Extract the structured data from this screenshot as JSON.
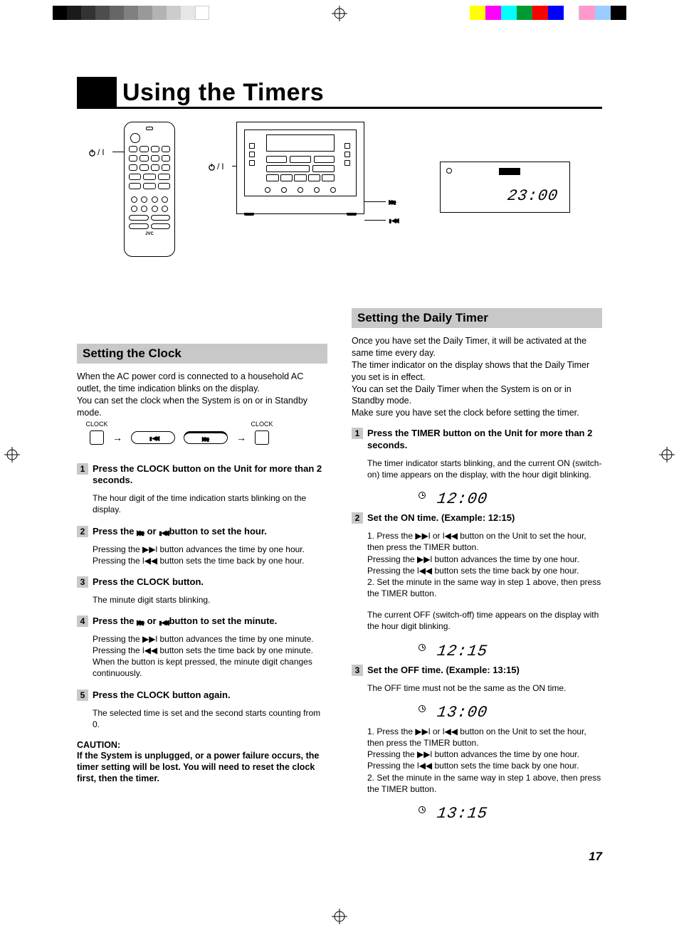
{
  "page_number": "17",
  "title": "Using the Timers",
  "lcd_main": "23:00",
  "remote_brand": "JVC",
  "power_label_suffix": "/ l",
  "unit_callouts": {
    "ff": "▶▶l",
    "rw": "l◀◀"
  },
  "left": {
    "heading": "Setting the Clock",
    "intro": "When the AC power cord is connected to a household AC outlet, the time indication blinks on the display.\nYou can set the clock when the System is on or in Standby mode.",
    "diagram_labels": {
      "clock": "CLOCK",
      "rw": "l◀◀",
      "ff": "▶▶l"
    },
    "steps": [
      {
        "n": "1",
        "t": "Press the CLOCK button on the Unit for more than 2 seconds.",
        "sub": "The hour digit of the time indication starts blinking on the display."
      },
      {
        "n": "2",
        "t_pre": "Press the ",
        "t_mid": " or ",
        "t_post": " button to set the hour.",
        "sub_lines": [
          "Pressing the ▶▶l button advances the time by one hour.",
          "Pressing the l◀◀ button sets the time back by one hour."
        ]
      },
      {
        "n": "3",
        "t": "Press the CLOCK button.",
        "sub": "The minute digit starts blinking."
      },
      {
        "n": "4",
        "t_pre": "Press the ",
        "t_mid": " or ",
        "t_post": " button to set the minute.",
        "sub_lines": [
          "Pressing the ▶▶l button advances the time by one minute.",
          "Pressing the l◀◀ button sets the time back by one minute.",
          "When the button is kept pressed, the minute digit changes continuously."
        ]
      },
      {
        "n": "5",
        "t": "Press the CLOCK button again.",
        "sub": "The selected time is set and the second starts counting from 0."
      }
    ],
    "caution_h": "CAUTION:",
    "caution_b": "If the System is unplugged, or a power failure occurs, the timer setting will be lost. You will need to reset the clock first, then the timer."
  },
  "right": {
    "heading": "Setting the Daily Timer",
    "intro": "Once you have set the Daily Timer, it will be activated at the same time every day.\nThe timer indicator on the display shows that the Daily Timer you set is in effect.\nYou can set the Daily Timer when the System is on or in Standby mode.\nMake sure you have set the clock before setting the timer.",
    "steps": [
      {
        "n": "1",
        "t": "Press the TIMER button on the Unit for more than 2 seconds.",
        "sub": "The timer indicator starts blinking, and the current ON (switch-on) time appears on the display, with the hour digit blinking.",
        "lcd": "12:00"
      },
      {
        "n": "2",
        "t": "Set the ON time. (Example: 12:15)",
        "sub_lines": [
          "1. Press the ▶▶l or l◀◀ button on the Unit to set the hour, then press the TIMER button.",
          "   Pressing the ▶▶l button advances the time by one hour.",
          "   Pressing the l◀◀ button sets the time back by one hour.",
          "2. Set the minute in the same way in step 1 above, then press the TIMER button."
        ],
        "sub_after": "The current OFF (switch-off) time appears on the display with the hour digit blinking.",
        "lcd": "12:15"
      },
      {
        "n": "3",
        "t": "Set the OFF time. (Example: 13:15)",
        "sub_top": "The OFF time must not be the same as the ON time.",
        "lcd1": "13:00",
        "sub_lines": [
          "1. Press the ▶▶l or l◀◀ button on the Unit to set the hour, then press the TIMER button.",
          "   Pressing the ▶▶l button advances the time by one hour.",
          "   Pressing the l◀◀ button sets the time back by one hour.",
          "2. Set the minute in the same way in step 1 above, then press the TIMER button."
        ],
        "lcd2": "13:15"
      }
    ]
  }
}
